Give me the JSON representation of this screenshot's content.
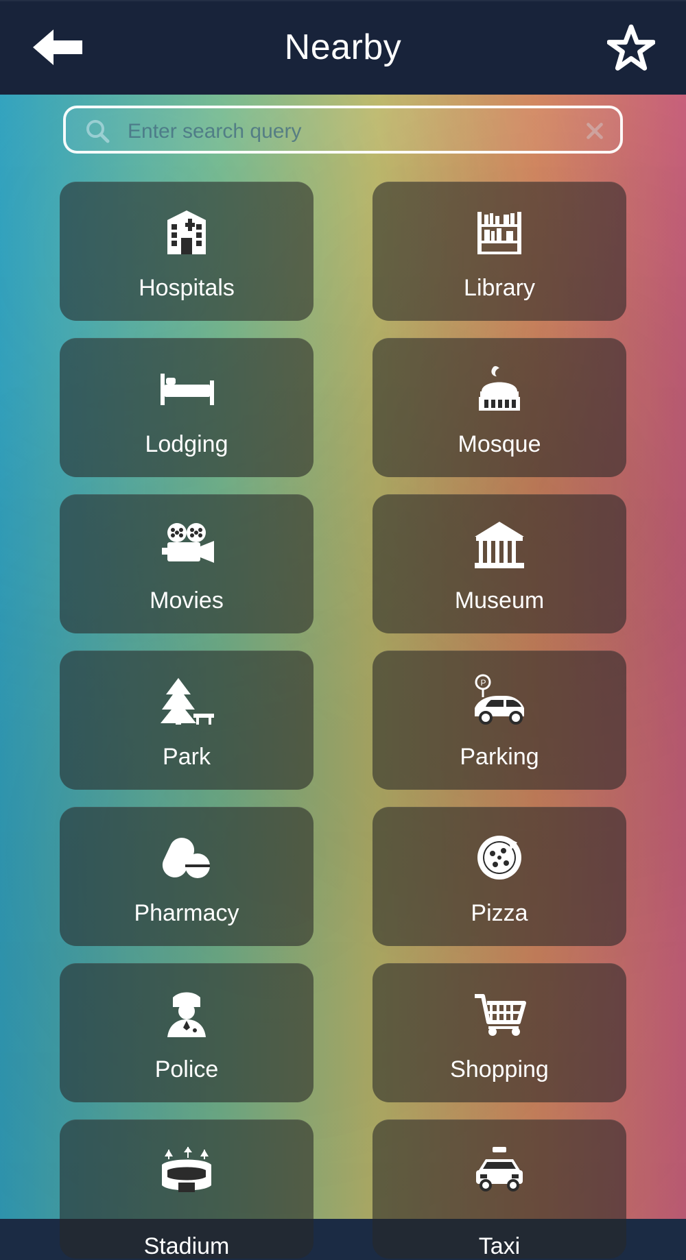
{
  "header": {
    "title": "Nearby",
    "icons": {
      "back": "back-arrow-icon",
      "favorite": "star-outline-icon"
    }
  },
  "search": {
    "placeholder": "Enter search query",
    "value": ""
  },
  "categories": [
    {
      "label": "Hospitals",
      "icon": "hospital-icon"
    },
    {
      "label": "Library",
      "icon": "bookshelf-icon"
    },
    {
      "label": "Lodging",
      "icon": "bed-icon"
    },
    {
      "label": "Mosque",
      "icon": "mosque-icon"
    },
    {
      "label": "Movies",
      "icon": "movie-camera-icon"
    },
    {
      "label": "Museum",
      "icon": "museum-icon"
    },
    {
      "label": "Park",
      "icon": "tree-bench-icon"
    },
    {
      "label": "Parking",
      "icon": "car-parking-icon"
    },
    {
      "label": "Pharmacy",
      "icon": "pill-icon"
    },
    {
      "label": "Pizza",
      "icon": "pizza-icon"
    },
    {
      "label": "Police",
      "icon": "police-officer-icon"
    },
    {
      "label": "Shopping",
      "icon": "shopping-cart-icon"
    },
    {
      "label": "Stadium",
      "icon": "stadium-icon"
    },
    {
      "label": "Taxi",
      "icon": "taxi-icon"
    }
  ],
  "colors": {
    "topbar": "#18233a",
    "tile": "rgba(40,40,40,0.58)"
  }
}
